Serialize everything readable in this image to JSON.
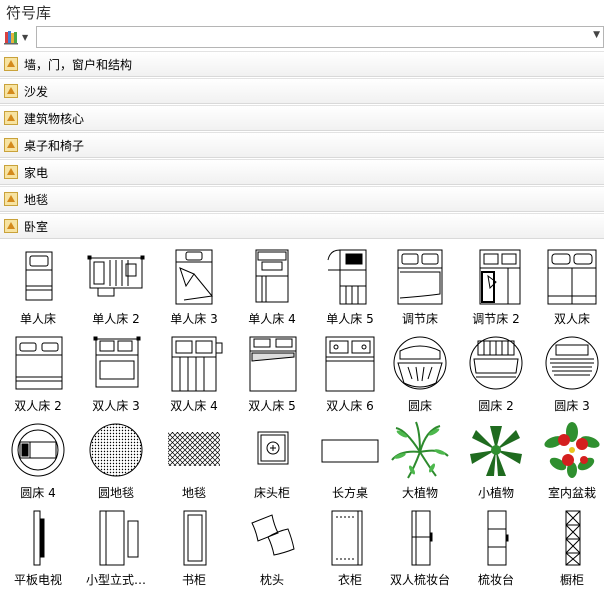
{
  "panel": {
    "title": "符号库"
  },
  "search": {
    "value": "",
    "placeholder": ""
  },
  "categories": [
    {
      "label": "墙，门，窗户和结构"
    },
    {
      "label": "沙发"
    },
    {
      "label": "建筑物核心"
    },
    {
      "label": "桌子和椅子"
    },
    {
      "label": "家电"
    },
    {
      "label": "地毯"
    },
    {
      "label": "卧室"
    }
  ],
  "symbols": [
    {
      "label": "单人床",
      "icon": "single-bed-icon"
    },
    {
      "label": "单人床 2",
      "icon": "single-bed-icon"
    },
    {
      "label": "单人床 3",
      "icon": "single-bed-icon"
    },
    {
      "label": "单人床 4",
      "icon": "single-bed-icon"
    },
    {
      "label": "单人床 5",
      "icon": "single-bed-icon"
    },
    {
      "label": "调节床",
      "icon": "adjustable-bed-icon"
    },
    {
      "label": "调节床 2",
      "icon": "adjustable-bed-icon"
    },
    {
      "label": "双人床",
      "icon": "double-bed-icon"
    },
    {
      "label": "双人床 2",
      "icon": "double-bed-icon"
    },
    {
      "label": "双人床 3",
      "icon": "double-bed-icon"
    },
    {
      "label": "双人床 4",
      "icon": "double-bed-icon"
    },
    {
      "label": "双人床 5",
      "icon": "double-bed-icon"
    },
    {
      "label": "双人床 6",
      "icon": "double-bed-icon"
    },
    {
      "label": "圆床",
      "icon": "round-bed-icon"
    },
    {
      "label": "圆床 2",
      "icon": "round-bed-icon"
    },
    {
      "label": "圆床 3",
      "icon": "round-bed-icon"
    },
    {
      "label": "圆床 4",
      "icon": "round-bed-icon"
    },
    {
      "label": "圆地毯",
      "icon": "round-rug-icon"
    },
    {
      "label": "地毯",
      "icon": "rug-icon"
    },
    {
      "label": "床头柜",
      "icon": "nightstand-icon"
    },
    {
      "label": "长方桌",
      "icon": "rectangular-table-icon"
    },
    {
      "label": "大植物",
      "icon": "large-plant-icon"
    },
    {
      "label": "小植物",
      "icon": "small-plant-icon"
    },
    {
      "label": "室内盆栽",
      "icon": "potted-plant-icon"
    },
    {
      "label": "平板电视",
      "icon": "flat-tv-icon"
    },
    {
      "label": "小型立式…",
      "icon": "small-cabinet-icon"
    },
    {
      "label": "书柜",
      "icon": "bookcase-icon"
    },
    {
      "label": "枕头",
      "icon": "pillows-icon"
    },
    {
      "label": "衣柜",
      "icon": "wardrobe-icon"
    },
    {
      "label": "双人梳妆台",
      "icon": "double-dresser-icon"
    },
    {
      "label": "梳妆台",
      "icon": "dresser-icon"
    },
    {
      "label": "橱柜",
      "icon": "cupboard-icon"
    }
  ]
}
